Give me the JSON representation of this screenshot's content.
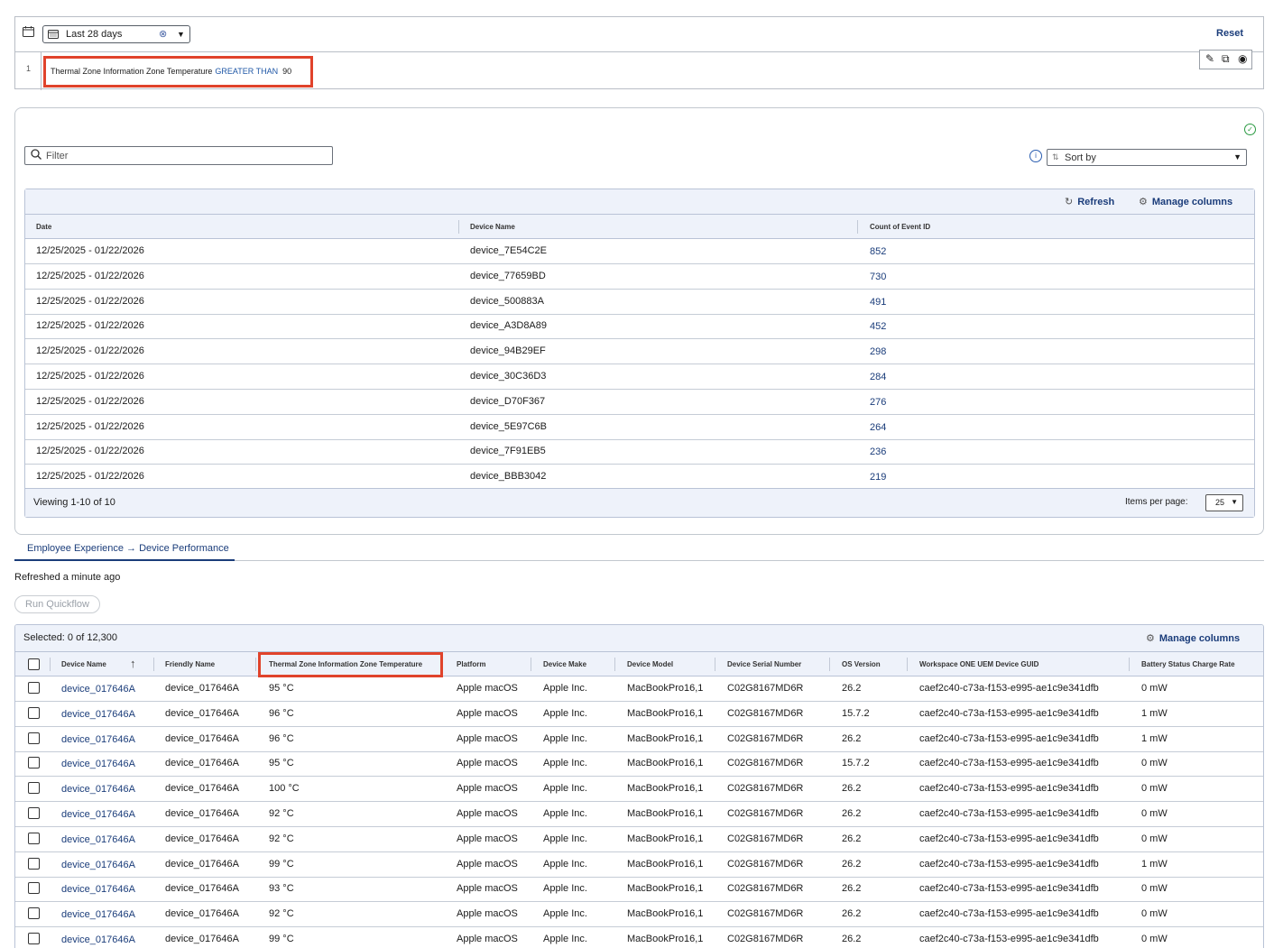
{
  "filter": {
    "date_range": "Last 28 days",
    "reset_label": "Reset",
    "rule_index": "1",
    "rule_field": "Thermal Zone Information Zone Temperature",
    "rule_operator": "GREATER THAN",
    "rule_value": "90"
  },
  "results": {
    "filter_placeholder": "Filter",
    "sort_placeholder": "Sort by",
    "refresh_label": "Refresh",
    "manage_columns_label": "Manage columns",
    "columns": [
      "Date",
      "Device Name",
      "Count of Event ID"
    ],
    "rows": [
      [
        "12/25/2025 - 01/22/2026",
        "device_7E54C2E",
        "852"
      ],
      [
        "12/25/2025 - 01/22/2026",
        "device_77659BD",
        "730"
      ],
      [
        "12/25/2025 - 01/22/2026",
        "device_500883A",
        "491"
      ],
      [
        "12/25/2025 - 01/22/2026",
        "device_A3D8A89",
        "452"
      ],
      [
        "12/25/2025 - 01/22/2026",
        "device_94B29EF",
        "298"
      ],
      [
        "12/25/2025 - 01/22/2026",
        "device_30C36D3",
        "284"
      ],
      [
        "12/25/2025 - 01/22/2026",
        "device_D70F367",
        "276"
      ],
      [
        "12/25/2025 - 01/22/2026",
        "device_5E97C6B",
        "264"
      ],
      [
        "12/25/2025 - 01/22/2026",
        "device_7F91EB5",
        "236"
      ],
      [
        "12/25/2025 - 01/22/2026",
        "device_BBB3042",
        "219"
      ]
    ],
    "viewing": "Viewing 1-10 of 10",
    "items_per_page_label": "Items per page:",
    "items_per_page": "25"
  },
  "tab": {
    "label": "Employee Experience → Device Performance"
  },
  "refreshed": "Refreshed a minute ago",
  "run_quickflow_label": "Run Quickflow",
  "devices": {
    "selected": "Selected: 0 of 12,300",
    "manage_columns_label": "Manage columns",
    "columns": [
      "Device Name",
      "Friendly Name",
      "Thermal Zone Information Zone Temperature",
      "Platform",
      "Device Make",
      "Device Model",
      "Device Serial Number",
      "OS Version",
      "Workspace ONE UEM Device GUID",
      "Battery Status Charge Rate"
    ],
    "rows": [
      [
        "device_017646A",
        "device_017646A",
        "95 °C",
        "Apple macOS",
        "Apple Inc.",
        "MacBookPro16,1",
        "C02G8167MD6R",
        "26.2",
        "caef2c40-c73a-f153-e995-ae1c9e341dfb",
        "0 mW"
      ],
      [
        "device_017646A",
        "device_017646A",
        "96 °C",
        "Apple macOS",
        "Apple Inc.",
        "MacBookPro16,1",
        "C02G8167MD6R",
        "15.7.2",
        "caef2c40-c73a-f153-e995-ae1c9e341dfb",
        "1 mW"
      ],
      [
        "device_017646A",
        "device_017646A",
        "96 °C",
        "Apple macOS",
        "Apple Inc.",
        "MacBookPro16,1",
        "C02G8167MD6R",
        "26.2",
        "caef2c40-c73a-f153-e995-ae1c9e341dfb",
        "1 mW"
      ],
      [
        "device_017646A",
        "device_017646A",
        "95 °C",
        "Apple macOS",
        "Apple Inc.",
        "MacBookPro16,1",
        "C02G8167MD6R",
        "15.7.2",
        "caef2c40-c73a-f153-e995-ae1c9e341dfb",
        "0 mW"
      ],
      [
        "device_017646A",
        "device_017646A",
        "100 °C",
        "Apple macOS",
        "Apple Inc.",
        "MacBookPro16,1",
        "C02G8167MD6R",
        "26.2",
        "caef2c40-c73a-f153-e995-ae1c9e341dfb",
        "0 mW"
      ],
      [
        "device_017646A",
        "device_017646A",
        "92 °C",
        "Apple macOS",
        "Apple Inc.",
        "MacBookPro16,1",
        "C02G8167MD6R",
        "26.2",
        "caef2c40-c73a-f153-e995-ae1c9e341dfb",
        "0 mW"
      ],
      [
        "device_017646A",
        "device_017646A",
        "92 °C",
        "Apple macOS",
        "Apple Inc.",
        "MacBookPro16,1",
        "C02G8167MD6R",
        "26.2",
        "caef2c40-c73a-f153-e995-ae1c9e341dfb",
        "0 mW"
      ],
      [
        "device_017646A",
        "device_017646A",
        "99 °C",
        "Apple macOS",
        "Apple Inc.",
        "MacBookPro16,1",
        "C02G8167MD6R",
        "26.2",
        "caef2c40-c73a-f153-e995-ae1c9e341dfb",
        "1 mW"
      ],
      [
        "device_017646A",
        "device_017646A",
        "93 °C",
        "Apple macOS",
        "Apple Inc.",
        "MacBookPro16,1",
        "C02G8167MD6R",
        "26.2",
        "caef2c40-c73a-f153-e995-ae1c9e341dfb",
        "0 mW"
      ],
      [
        "device_017646A",
        "device_017646A",
        "92 °C",
        "Apple macOS",
        "Apple Inc.",
        "MacBookPro16,1",
        "C02G8167MD6R",
        "26.2",
        "caef2c40-c73a-f153-e995-ae1c9e341dfb",
        "0 mW"
      ],
      [
        "device_017646A",
        "device_017646A",
        "99 °C",
        "Apple macOS",
        "Apple Inc.",
        "MacBookPro16,1",
        "C02G8167MD6R",
        "26.2",
        "caef2c40-c73a-f153-e995-ae1c9e341dfb",
        "0 mW"
      ]
    ]
  }
}
